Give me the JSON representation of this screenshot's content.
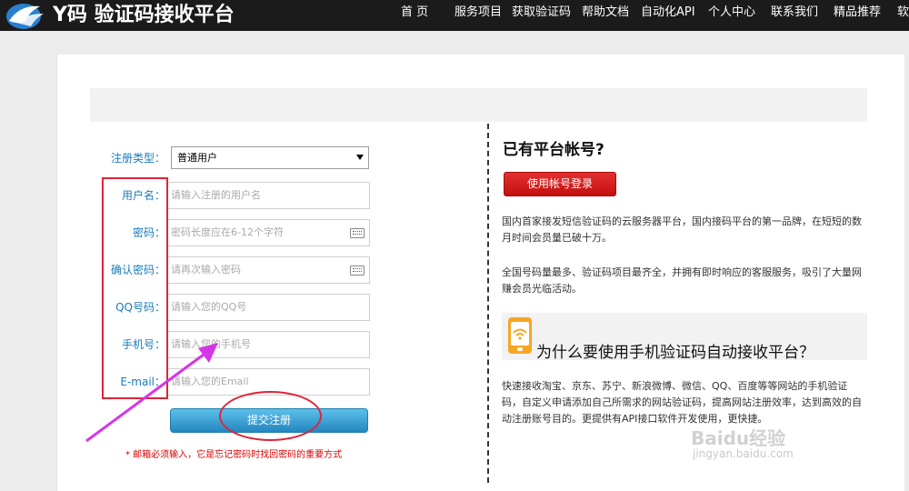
{
  "header": {
    "logo_text": "Y码 验证码接收平台",
    "nav": [
      "首 页",
      "服务项目",
      "获取验证码",
      "帮助文档",
      "自动化API",
      "个人中心",
      "联系我们",
      "精品推荐",
      "软"
    ]
  },
  "form": {
    "type_label": "注册类型：",
    "type_value": "普通用户",
    "fields": [
      {
        "label": "用户名：",
        "placeholder": "请输入注册的用户名"
      },
      {
        "label": "密码：",
        "placeholder": "密码长度应在6-12个字符"
      },
      {
        "label": "确认密码：",
        "placeholder": "请再次输入密码"
      },
      {
        "label": "QQ号码：",
        "placeholder": "请输入您的QQ号"
      },
      {
        "label": "手机号：",
        "placeholder": "请输入您的手机号"
      },
      {
        "label": "E-mail：",
        "placeholder": "请输入您的Email"
      }
    ],
    "submit_label": "提交注册",
    "note": "* 邮箱必须输入，它是忘记密码时找回密码的重要方式"
  },
  "right": {
    "title": "已有平台帐号?",
    "login_button": "使用帐号登录",
    "para1": "国内首家接发短信验证码的云服务器平台，国内接码平台的第一品牌，在短短的数月时间会员量已破十万。",
    "para2": "全国号码量最多、验证码项目最齐全，并拥有即时响应的客服服务，吸引了大量网赚会员光临活动。",
    "feature_title": "为什么要使用手机验证码自动接收平台？",
    "para3": "快速接收淘宝、京东、苏宁、新浪微博、微信、QQ、百度等等网站的手机验证码，自定义申请添加自己所需求的网站验证码，提高网站注册效率，达到高效的自动注册账号目的。更提供有API接口软件开发使用，更快捷。"
  },
  "watermark": {
    "text": "Baidu经验",
    "sub": "jingyan.baidu.com"
  },
  "colors": {
    "accent_blue": "#1a7bb9",
    "annotation_red": "#e0243a",
    "arrow_magenta": "#d535e8",
    "login_red": "#d01818"
  }
}
